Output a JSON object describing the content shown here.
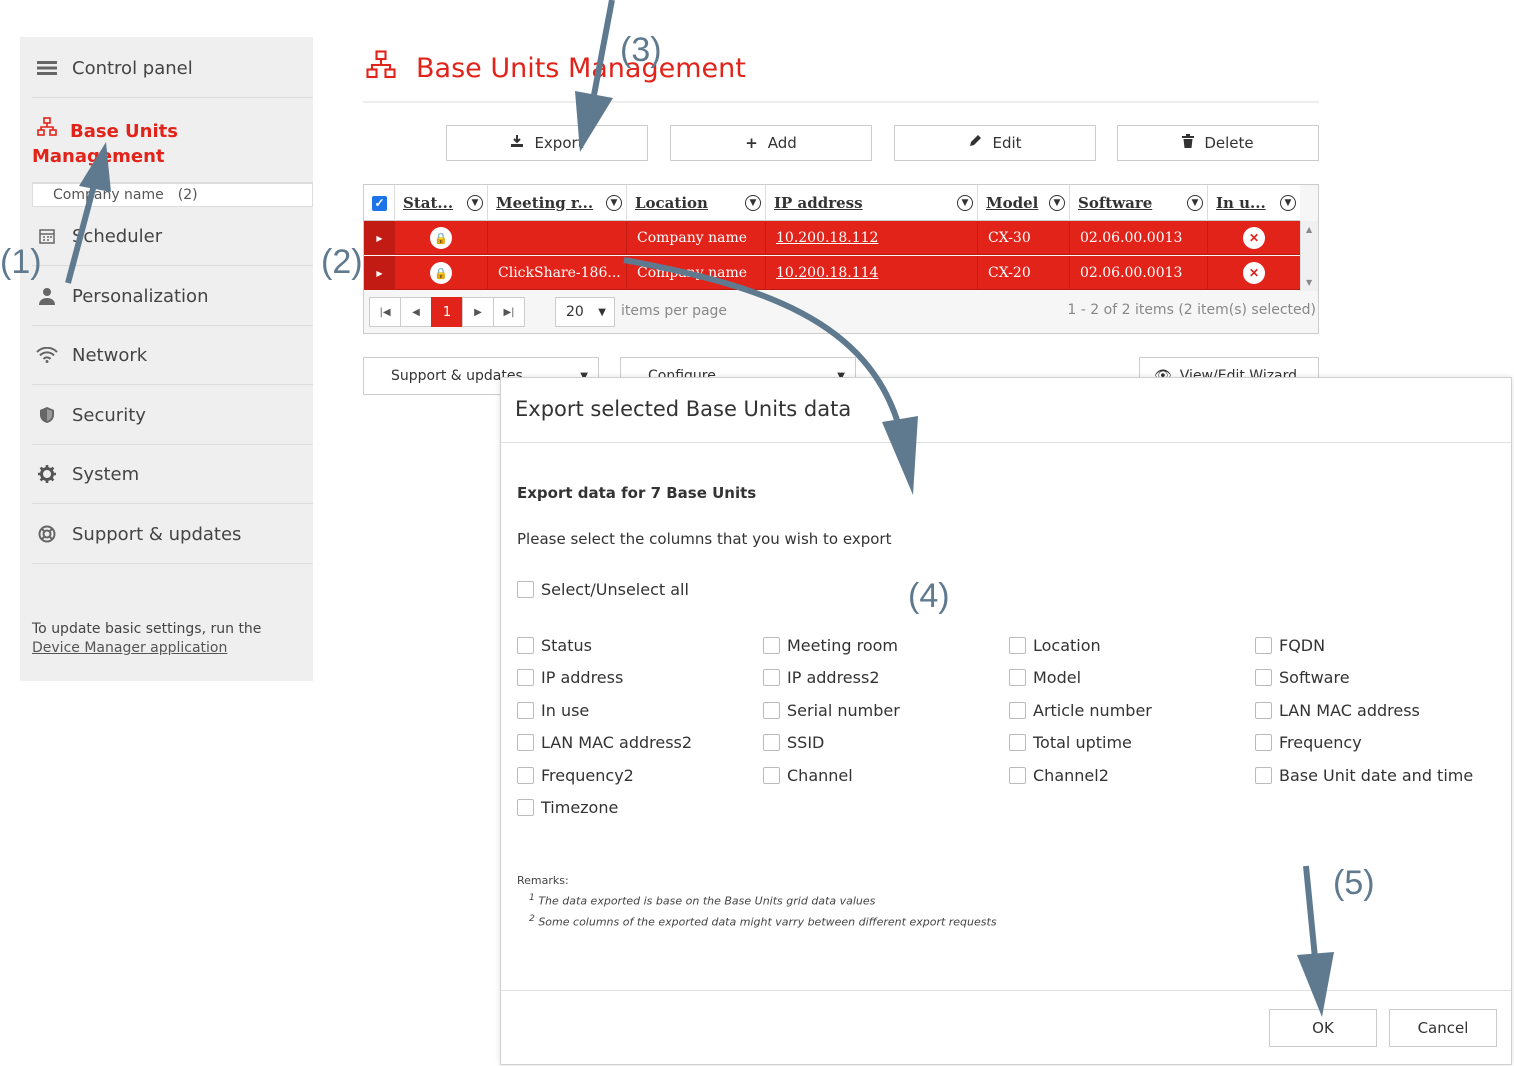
{
  "sidebar": {
    "items": [
      {
        "label": "Control panel",
        "icon": "control-panel-icon"
      },
      {
        "label": "Base Units Management",
        "icon": "network-tree-icon",
        "active": true
      },
      {
        "label": "Scheduler",
        "icon": "calendar-icon"
      },
      {
        "label": "Personalization",
        "icon": "user-icon"
      },
      {
        "label": "Network",
        "icon": "wifi-icon"
      },
      {
        "label": "Security",
        "icon": "shield-icon"
      },
      {
        "label": "System",
        "icon": "gear-icon"
      },
      {
        "label": "Support & updates",
        "icon": "lifebuoy-icon"
      }
    ],
    "sub_item": {
      "label": "Company name",
      "count": "(2)"
    },
    "note": "To update basic settings, run the",
    "note_link": "Device Manager application"
  },
  "main": {
    "title": "Base Units Management",
    "toolbar": {
      "export": "Export",
      "add": "Add",
      "edit": "Edit",
      "delete": "Delete"
    },
    "grid": {
      "columns": [
        "Stat...",
        "Meeting r...",
        "Location",
        "IP address",
        "Model",
        "Software",
        "In u..."
      ],
      "rows": [
        {
          "meeting_room": "",
          "location": "Company name",
          "ip": "10.200.18.112",
          "model": "CX-30",
          "software": "02.06.00.0013"
        },
        {
          "meeting_room": "ClickShare-186...",
          "location": "Company name",
          "ip": "10.200.18.114",
          "model": "CX-20",
          "software": "02.06.00.0013"
        }
      ],
      "pager": {
        "current_page": "1",
        "page_size": "20",
        "per_page_label": "items per page",
        "info": "1 - 2 of 2 items (2 item(s) selected)"
      }
    },
    "dropdowns": {
      "support": "Support & updates",
      "configure": "Configure",
      "wizard": "View/Edit Wizard"
    }
  },
  "dialog": {
    "title": "Export selected Base Units data",
    "heading": "Export data for 7 Base Units",
    "instruction": "Please select the columns that you wish to export",
    "select_all": "Select/Unselect all",
    "columns": [
      "Status",
      "Meeting room",
      "Location",
      "FQDN",
      "IP address",
      "IP address2",
      "Model",
      "Software",
      "In use",
      "Serial number",
      "Article number",
      "LAN MAC address",
      "LAN MAC address2",
      "SSID",
      "Total uptime",
      "Frequency",
      "Frequency2",
      "Channel",
      "Channel2",
      "Base Unit date and time",
      "Timezone"
    ],
    "remarks_label": "Remarks:",
    "remarks": [
      "The data exported is base on the Base Units grid data values",
      "Some columns of the exported data might varry between different export requests"
    ],
    "ok": "OK",
    "cancel": "Cancel"
  },
  "annotations": [
    "(1)",
    "(2)",
    "(3)",
    "(4)",
    "(5)"
  ],
  "colors": {
    "accent": "#e2231a",
    "annotation": "#5f7a8f"
  }
}
